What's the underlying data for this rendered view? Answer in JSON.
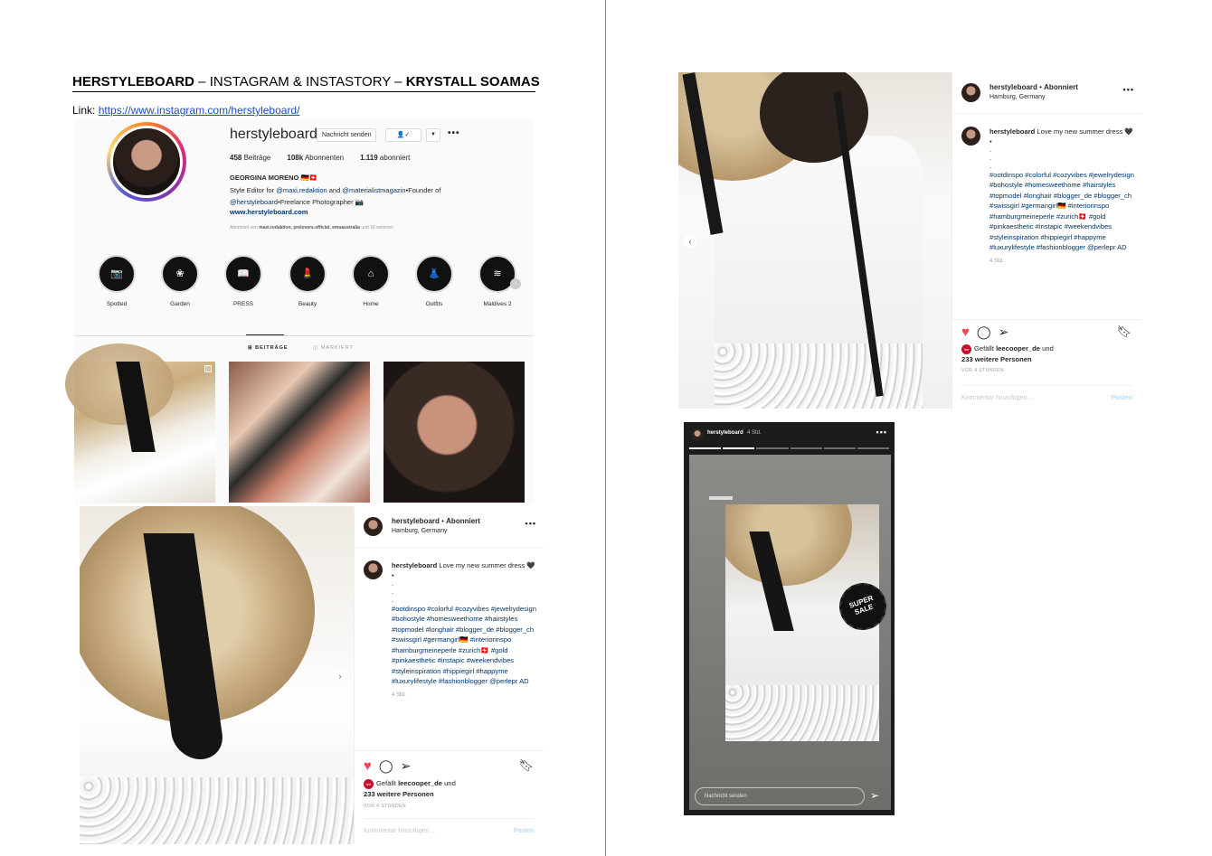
{
  "doc": {
    "heading_bold1": "HERSTYLEBOARD",
    "heading_mid": " – INSTAGRAM & INSTASTORY – ",
    "heading_bold2": "KRYSTALL SOAMAS",
    "link_label": "Link: ",
    "link_url": "https://www.instagram.com/herstyleboard/"
  },
  "profile": {
    "username": "herstyleboard",
    "message_button": "Nachricht senden",
    "follow_icon": "person-check-icon",
    "dropdown_icon": "chevron-down-icon",
    "more": "•••",
    "stats": {
      "posts_num": "458",
      "posts_label": " Beiträge",
      "followers_num": "108k",
      "followers_label": " Abonnenten",
      "following_num": "1.119",
      "following_label": " abonniert"
    },
    "full_name": "GEORGINA MORENO 🇩🇪🇨🇭",
    "bio_1": "Style Editor for ",
    "bio_mention1": "@maxi.redaktion",
    "bio_2": " and ",
    "bio_mention2": "@materialistmagazin",
    "bio_3": "•Founder of",
    "bio_mention3": "@herstyleboard",
    "bio_4": "•Freelance Photographer 📷",
    "website": "www.herstyleboard.com",
    "followed_by_prefix": "Abonniert von ",
    "followed_by_names": "maxi.redaktion, prelovers.official, emuaustralia",
    "followed_by_suffix": " und 18 weiteren",
    "highlights": [
      {
        "label": "Spotted",
        "icon": "camera-icon",
        "glyph": "📷"
      },
      {
        "label": "Garden",
        "icon": "flower-icon",
        "glyph": "❀"
      },
      {
        "label": "PRESS",
        "icon": "book-icon",
        "glyph": "📖"
      },
      {
        "label": "Beauty",
        "icon": "lipstick-icon",
        "glyph": "💄"
      },
      {
        "label": "Home",
        "icon": "house-icon",
        "glyph": "⌂"
      },
      {
        "label": "Outfits",
        "icon": "dress-icon",
        "glyph": "👗"
      },
      {
        "label": "Maldives 2",
        "icon": "waves-icon",
        "glyph": "≋"
      }
    ],
    "tab_posts": "⊞ BEITRÄGE",
    "tab_tagged": "◫ MARKIERT"
  },
  "post": {
    "username": "herstyleboard",
    "dot": " • ",
    "follow_status": "Abonniert",
    "location": "Hamburg, Germany",
    "more": "•••",
    "caption_user": "herstyleboard",
    "caption_text": " Love my new summer dress 🖤",
    "caption_dots": "•\n.\n.\n.",
    "hashtags": "#ootdinspo #colorful #cozyvibes #jewelrydesign #bohostyle #homesweethome #hairstyles #topmodel #longhair #blogger_de #blogger_ch #swissgirl #germangirl🇩🇪 #interiorinspo #hamburgmeineperle #zurich🇨🇭 #gold #pinkaesthetic #instapic #weekendvibes #styleinspiration #hippiegirl #happyme #luxurylifestyle #fashionblogger @perlepr AD",
    "time": "4 Std.",
    "likes_badge": "lee",
    "likes_prefix": "Gefällt ",
    "likes_user": "leecooper_de",
    "likes_mid": " und",
    "likes_count": "233 weitere Personen",
    "ago": "VOR 4 STUNDEN",
    "comment_placeholder": "Kommentar hinzufügen ...",
    "post_button": "Posten"
  },
  "story": {
    "username": "herstyleboard",
    "time": "4 Std.",
    "more": "•••",
    "sticker_text": "SUPER SALE",
    "reply_placeholder": "Nachricht senden",
    "send_icon": "send-icon"
  }
}
